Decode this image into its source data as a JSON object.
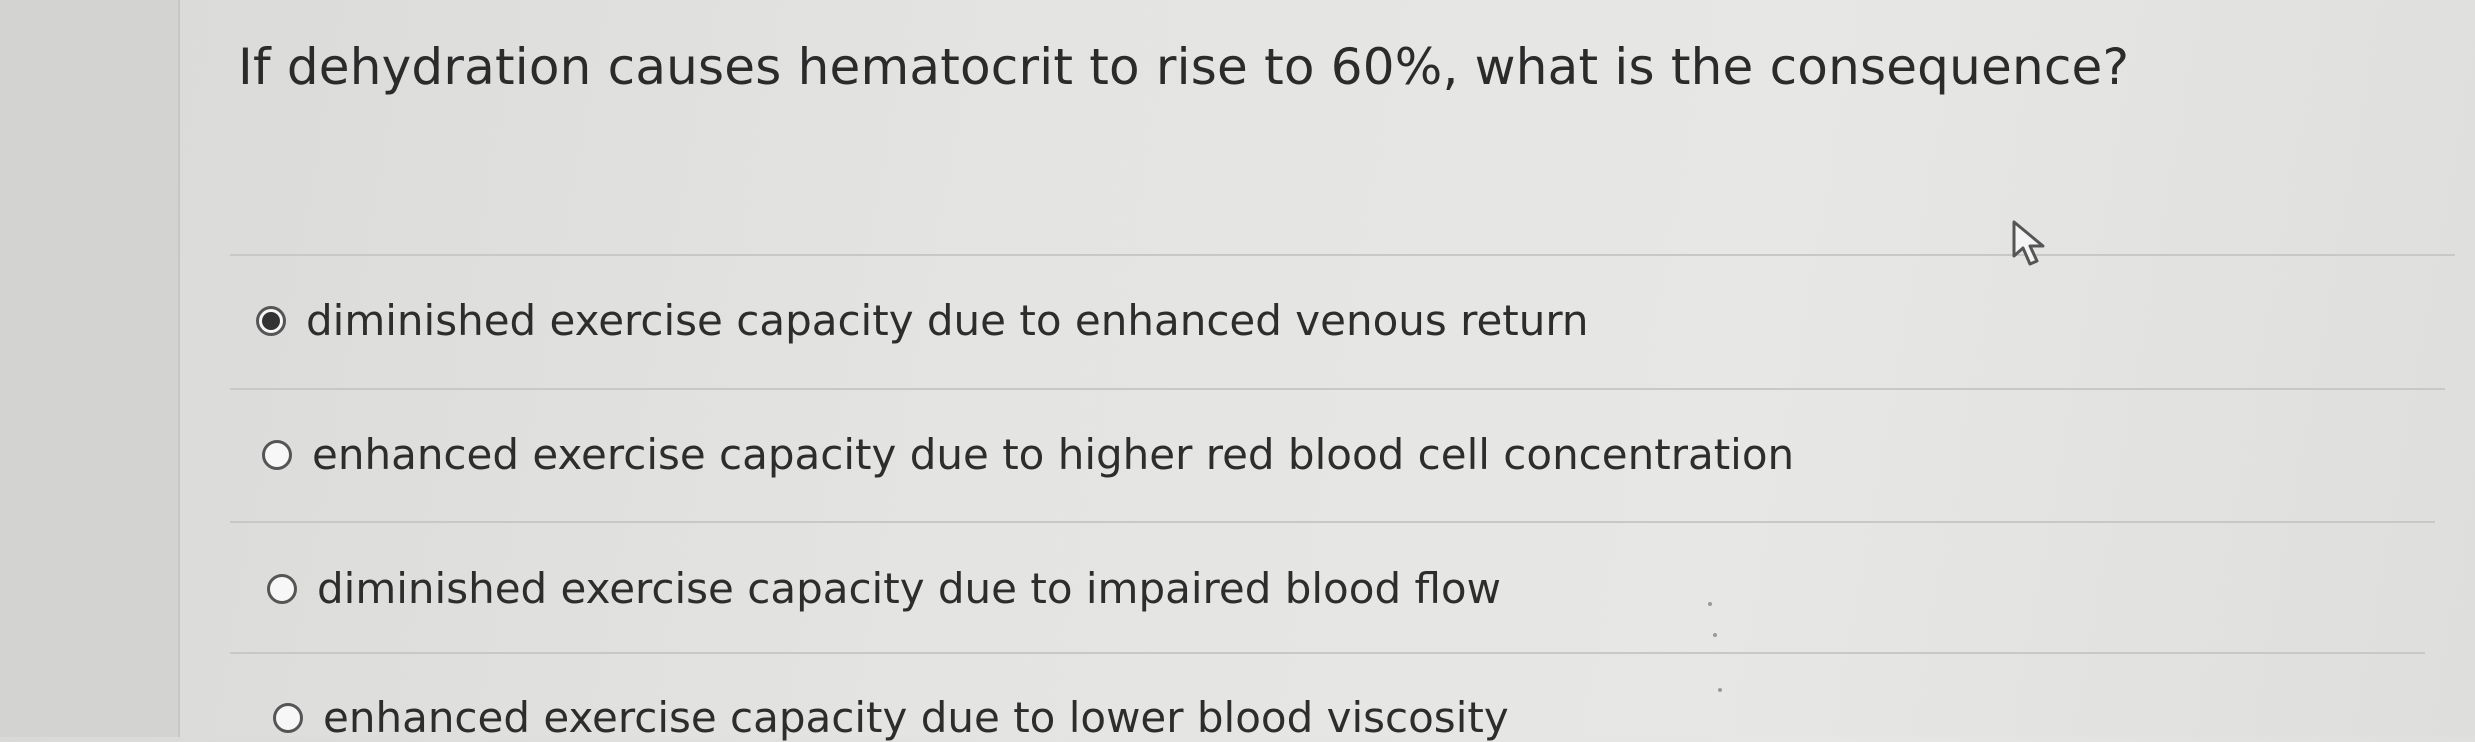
{
  "question": {
    "text": "If dehydration causes hematocrit to rise to 60%, what is the consequence?"
  },
  "options": [
    {
      "label": "diminished exercise capacity due to enhanced venous return",
      "selected": true
    },
    {
      "label": "enhanced exercise capacity due to higher red blood cell concentration",
      "selected": false
    },
    {
      "label": "diminished exercise capacity due to impaired blood flow",
      "selected": false
    },
    {
      "label": "enhanced exercise capacity due to lower blood viscosity",
      "selected": false
    }
  ],
  "icons": {
    "cursor": "mouse-pointer-icon",
    "radio": "radio-button-icon"
  },
  "colors": {
    "background": "#e3e3e1",
    "text": "#2d2d2d",
    "radio_border": "#555555",
    "selected_dot": "#333333",
    "divider": "#c8c8c6"
  }
}
